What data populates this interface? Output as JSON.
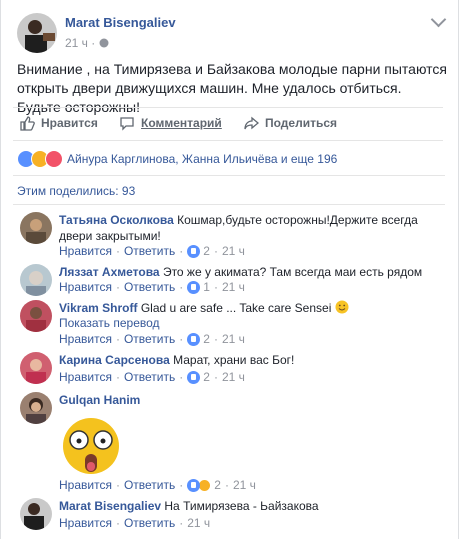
{
  "post": {
    "author": "Marat Bisengaliev",
    "time": "21 ч",
    "privacy": "·",
    "text": "Внимание , на Тимирязева и Байзакова молодые парни пытаются открыть двери движущихся машин. Мне удалось отбиться. Будьте осторожны!"
  },
  "actions": {
    "like": "Нравится",
    "comment": "Комментарий",
    "share": "Поделиться"
  },
  "reactions": {
    "text": "Айнура Карглинова, Жанна Ильичёва и еще 196"
  },
  "shared": "Этим поделились: 93",
  "comment_labels": {
    "like": "Нравится",
    "reply": "Ответить",
    "translate": "Показать перевод"
  },
  "comments": [
    {
      "name": "Татьяна Осколкова",
      "text": "Кошмар,будьте осторожны!Держите всегда двери закрытыми!",
      "likes": "2",
      "time": "21 ч"
    },
    {
      "name": "Ляззат Ахметова",
      "text": "Это же у акимата? Там всегда маи есть рядом",
      "likes": "1",
      "time": "21 ч"
    },
    {
      "name": "Vikram Shroff",
      "text": "Glad u are safe ... Take care Sensei",
      "likes": "2",
      "time": "21 ч"
    },
    {
      "name": "Карина Сарсенова",
      "text": "Марат, храни вас Бог!",
      "likes": "2",
      "time": "21 ч"
    },
    {
      "name": "Gulqan Hanim",
      "text": "",
      "likes": "2",
      "time": "21 ч"
    },
    {
      "name": "Marat Bisengaliev",
      "text": "На Тимирязева - Ьайзакова",
      "likes": "",
      "time": "21 ч"
    }
  ],
  "colors": {
    "link": "#365899",
    "meta": "#90949c",
    "like": "#5890ff"
  }
}
